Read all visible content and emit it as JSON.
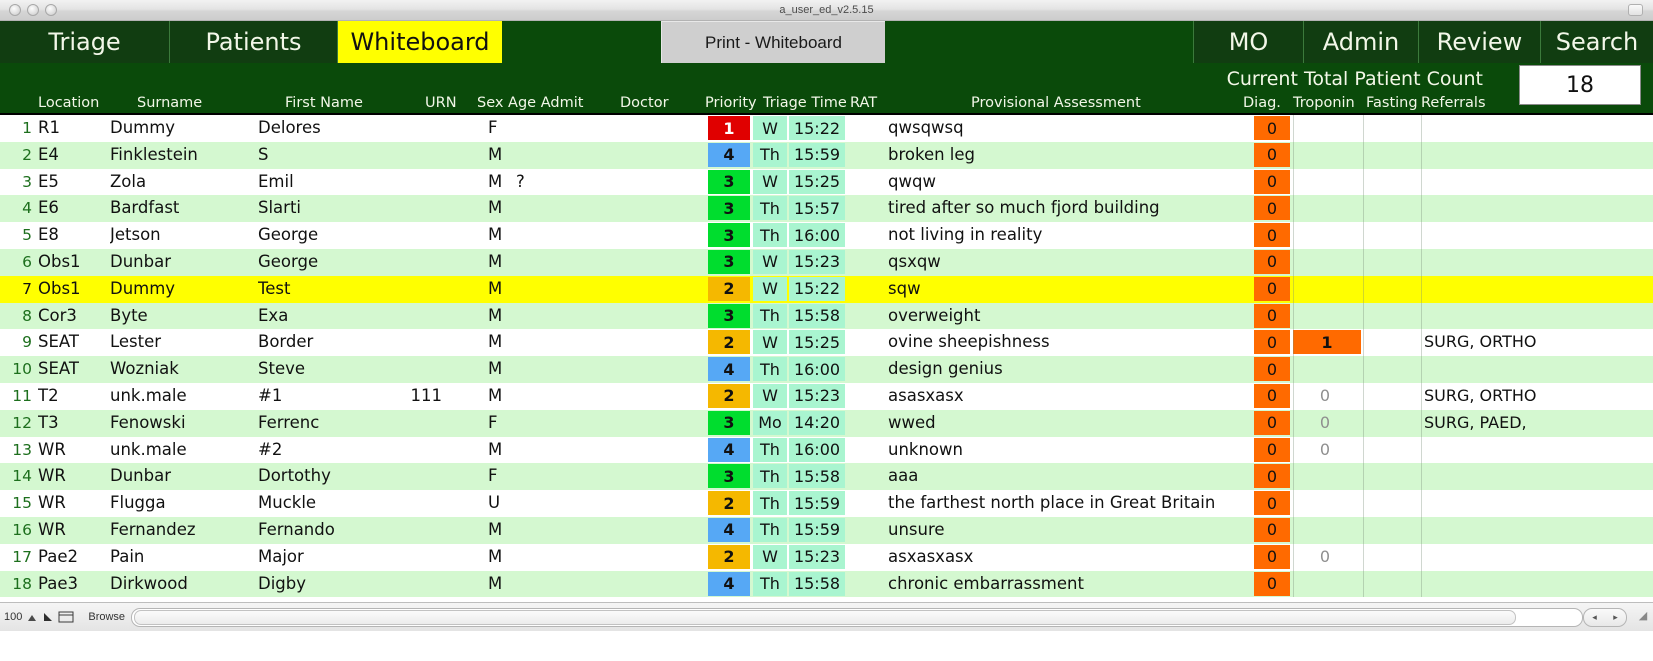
{
  "window": {
    "title": "a_user_ed_v2.5.15",
    "traffic_lights": [
      "close",
      "minimize",
      "zoom"
    ]
  },
  "nav": {
    "tabs": [
      {
        "label": "Triage",
        "active": false
      },
      {
        "label": "Patients",
        "active": false
      },
      {
        "label": "Whiteboard",
        "active": true
      }
    ],
    "print_button": "Print - Whiteboard",
    "right_tabs": [
      {
        "label": "MO"
      },
      {
        "label": "Admin"
      },
      {
        "label": "Review"
      },
      {
        "label": "Search"
      }
    ]
  },
  "subheader": {
    "count_label": "Current Total Patient Count",
    "count_value": "18"
  },
  "columns": {
    "location": "Location",
    "surname": "Surname",
    "first_name": "First Name",
    "urn": "URN",
    "sex_age_admit": "Sex Age Admit",
    "doctor": "Doctor",
    "priority": "Priority",
    "triage_time": "Triage Time",
    "rat": "RAT",
    "provisional_assessment": "Provisional Assessment",
    "diag": "Diag.",
    "troponin": "Troponin",
    "fasting": "Fasting",
    "referrals": "Referrals"
  },
  "colors": {
    "nav_green": "#113d11",
    "header_green": "#0a4a0a",
    "active_tab": "#ffff00",
    "row_alt": "#d4f8d0",
    "row_selected": "#ffff00",
    "priority_1": "#e00000",
    "priority_2": "#f5b800",
    "priority_3": "#00dd2e",
    "priority_4": "#56a8f5",
    "triage_cell": "#a9f5d0",
    "diag_orange": "#ff6a00"
  },
  "rows": [
    {
      "n": "1",
      "location": "R1",
      "surname": "Dummy",
      "first": "Delores",
      "urn": "",
      "sex": "F",
      "age": "",
      "admit": "",
      "doctor": "",
      "priority": "1",
      "day": "W",
      "time": "15:22",
      "assessment": "qwsqwsq",
      "diag": "0",
      "troponin": "",
      "troponin_flag": false,
      "fasting": "",
      "referrals": "",
      "selected": false
    },
    {
      "n": "2",
      "location": "E4",
      "surname": "Finklestein",
      "first": "S",
      "urn": "",
      "sex": "M",
      "age": "",
      "admit": "",
      "doctor": "",
      "priority": "4",
      "day": "Th",
      "time": "15:59",
      "assessment": "broken leg",
      "diag": "0",
      "troponin": "",
      "troponin_flag": false,
      "fasting": "",
      "referrals": "",
      "selected": false
    },
    {
      "n": "3",
      "location": "E5",
      "surname": "Zola",
      "first": "Emil",
      "urn": "",
      "sex": "M",
      "age": "?",
      "admit": "",
      "doctor": "",
      "priority": "3",
      "day": "W",
      "time": "15:25",
      "assessment": "qwqw",
      "diag": "0",
      "troponin": "",
      "troponin_flag": false,
      "fasting": "",
      "referrals": "",
      "selected": false
    },
    {
      "n": "4",
      "location": "E6",
      "surname": "Bardfast",
      "first": "Slarti",
      "urn": "",
      "sex": "M",
      "age": "",
      "admit": "",
      "doctor": "",
      "priority": "3",
      "day": "Th",
      "time": "15:57",
      "assessment": "tired after so much fjord building",
      "diag": "0",
      "troponin": "",
      "troponin_flag": false,
      "fasting": "",
      "referrals": "",
      "selected": false
    },
    {
      "n": "5",
      "location": "E8",
      "surname": "Jetson",
      "first": "George",
      "urn": "",
      "sex": "M",
      "age": "",
      "admit": "",
      "doctor": "",
      "priority": "3",
      "day": "Th",
      "time": "16:00",
      "assessment": "not living in reality",
      "diag": "0",
      "troponin": "",
      "troponin_flag": false,
      "fasting": "",
      "referrals": "",
      "selected": false
    },
    {
      "n": "6",
      "location": "Obs1",
      "surname": "Dunbar",
      "first": "George",
      "urn": "",
      "sex": "M",
      "age": "",
      "admit": "",
      "doctor": "",
      "priority": "3",
      "day": "W",
      "time": "15:23",
      "assessment": "qsxqw",
      "diag": "0",
      "troponin": "",
      "troponin_flag": false,
      "fasting": "",
      "referrals": "",
      "selected": false
    },
    {
      "n": "7",
      "location": "Obs1",
      "surname": "Dummy",
      "first": "Test",
      "urn": "",
      "sex": "M",
      "age": "",
      "admit": "",
      "doctor": "",
      "priority": "2",
      "day": "W",
      "time": "15:22",
      "assessment": "sqw",
      "diag": "0",
      "troponin": "",
      "troponin_flag": false,
      "fasting": "",
      "referrals": "",
      "selected": true
    },
    {
      "n": "8",
      "location": "Cor3",
      "surname": "Byte",
      "first": "Exa",
      "urn": "",
      "sex": "M",
      "age": "",
      "admit": "",
      "doctor": "",
      "priority": "3",
      "day": "Th",
      "time": "15:58",
      "assessment": "overweight",
      "diag": "0",
      "troponin": "",
      "troponin_flag": false,
      "fasting": "",
      "referrals": "",
      "selected": false
    },
    {
      "n": "9",
      "location": "SEAT",
      "surname": "Lester",
      "first": "Border",
      "urn": "",
      "sex": "M",
      "age": "",
      "admit": "",
      "doctor": "",
      "priority": "2",
      "day": "W",
      "time": "15:25",
      "assessment": "ovine sheepishness",
      "diag": "0",
      "troponin": "1",
      "troponin_flag": true,
      "fasting": "",
      "referrals": "SURG, ORTHO",
      "selected": false
    },
    {
      "n": "10",
      "location": "SEAT",
      "surname": "Wozniak",
      "first": "Steve",
      "urn": "",
      "sex": "M",
      "age": "",
      "admit": "",
      "doctor": "",
      "priority": "4",
      "day": "Th",
      "time": "16:00",
      "assessment": "design genius",
      "diag": "0",
      "troponin": "",
      "troponin_flag": false,
      "fasting": "",
      "referrals": "",
      "selected": false
    },
    {
      "n": "11",
      "location": "T2",
      "surname": "unk.male",
      "first": "#1",
      "urn": "111",
      "sex": "M",
      "age": "",
      "admit": "",
      "doctor": "",
      "priority": "2",
      "day": "W",
      "time": "15:23",
      "assessment": "asasxasx",
      "diag": "0",
      "troponin": "0",
      "troponin_flag": false,
      "fasting": "",
      "referrals": "SURG, ORTHO",
      "selected": false
    },
    {
      "n": "12",
      "location": "T3",
      "surname": "Fenowski",
      "first": "Ferrenc",
      "urn": "",
      "sex": "F",
      "age": "",
      "admit": "",
      "doctor": "",
      "priority": "3",
      "day": "Mo",
      "time": "14:20",
      "assessment": "wwed",
      "diag": "0",
      "troponin": "0",
      "troponin_flag": false,
      "fasting": "",
      "referrals": "SURG, PAED,",
      "selected": false
    },
    {
      "n": "13",
      "location": "WR",
      "surname": "unk.male",
      "first": "#2",
      "urn": "",
      "sex": "M",
      "age": "",
      "admit": "",
      "doctor": "",
      "priority": "4",
      "day": "Th",
      "time": "16:00",
      "assessment": "unknown",
      "diag": "0",
      "troponin": "0",
      "troponin_flag": false,
      "fasting": "",
      "referrals": "",
      "selected": false
    },
    {
      "n": "14",
      "location": "WR",
      "surname": "Dunbar",
      "first": "Dortothy",
      "urn": "",
      "sex": "F",
      "age": "",
      "admit": "",
      "doctor": "",
      "priority": "3",
      "day": "Th",
      "time": "15:58",
      "assessment": "aaa",
      "diag": "0",
      "troponin": "",
      "troponin_flag": false,
      "fasting": "",
      "referrals": "",
      "selected": false
    },
    {
      "n": "15",
      "location": "WR",
      "surname": "Flugga",
      "first": "Muckle",
      "urn": "",
      "sex": "U",
      "age": "",
      "admit": "",
      "doctor": "",
      "priority": "2",
      "day": "Th",
      "time": "15:59",
      "assessment": "the farthest north place in Great Britain",
      "diag": "0",
      "troponin": "",
      "troponin_flag": false,
      "fasting": "",
      "referrals": "",
      "selected": false
    },
    {
      "n": "16",
      "location": "WR",
      "surname": "Fernandez",
      "first": "Fernando",
      "urn": "",
      "sex": "M",
      "age": "",
      "admit": "",
      "doctor": "",
      "priority": "4",
      "day": "Th",
      "time": "15:59",
      "assessment": "unsure",
      "diag": "0",
      "troponin": "",
      "troponin_flag": false,
      "fasting": "",
      "referrals": "",
      "selected": false
    },
    {
      "n": "17",
      "location": "Pae2",
      "surname": "Pain",
      "first": "Major",
      "urn": "",
      "sex": "M",
      "age": "",
      "admit": "",
      "doctor": "",
      "priority": "2",
      "day": "W",
      "time": "15:23",
      "assessment": "asxasxasx",
      "diag": "0",
      "troponin": "0",
      "troponin_flag": false,
      "fasting": "",
      "referrals": "",
      "selected": false
    },
    {
      "n": "18",
      "location": "Pae3",
      "surname": "Dirkwood",
      "first": "Digby",
      "urn": "",
      "sex": "M",
      "age": "",
      "admit": "",
      "doctor": "",
      "priority": "4",
      "day": "Th",
      "time": "15:58",
      "assessment": "chronic embarrassment",
      "diag": "0",
      "troponin": "",
      "troponin_flag": false,
      "fasting": "",
      "referrals": "",
      "selected": false
    }
  ],
  "statusbar": {
    "zoom_level": "100",
    "mode": "Browse"
  }
}
